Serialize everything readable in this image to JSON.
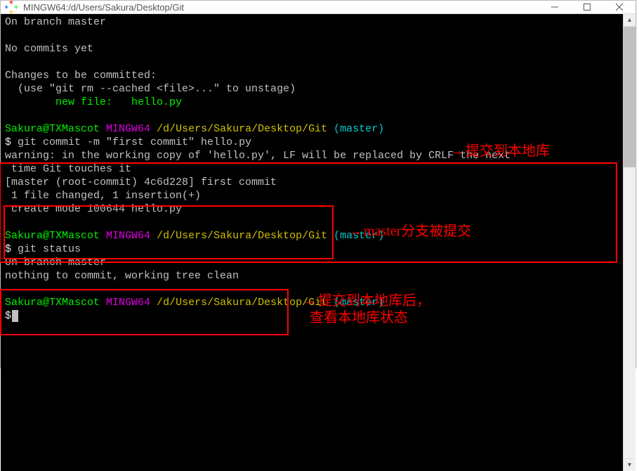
{
  "window": {
    "title": "MINGW64:/d/Users/Sakura/Desktop/Git"
  },
  "prompt": {
    "user": "Sakura@TXMascot",
    "shell": "MINGW64",
    "path": "/d/Users/Sakura/Desktop/Git",
    "branch": "(master)"
  },
  "status_output": {
    "line1": "On branch master",
    "blank1": "",
    "line2": "No commits yet",
    "blank2": "",
    "line3": "Changes to be committed:",
    "line4": "  (use \"git rm --cached <file>...\" to unstage)",
    "line5_label": "        new file:   ",
    "line5_file": "hello.py"
  },
  "commit": {
    "cmd_prefix": "$ ",
    "cmd": "git commit -m \"first commit\" hello.py",
    "warn": "warning: in the working copy of 'hello.py', LF will be replaced by CRLF the next\n time Git touches it",
    "result1": "[master (root-commit) 4c6d228] first commit",
    "result2": " 1 file changed, 1 insertion(+)",
    "result3": " create mode 100644 hello.py"
  },
  "status2": {
    "cmd_prefix": "$ ",
    "cmd": "git status",
    "line1": "On branch master",
    "line2": "nothing to commit, working tree clean"
  },
  "last_prompt": {
    "prefix": "$"
  },
  "annotations": {
    "a1": "提交到本地库",
    "a2": "master分支被提交",
    "a3_line1": "提交到本地库后，",
    "a3_line2": "查看本地库状态"
  }
}
